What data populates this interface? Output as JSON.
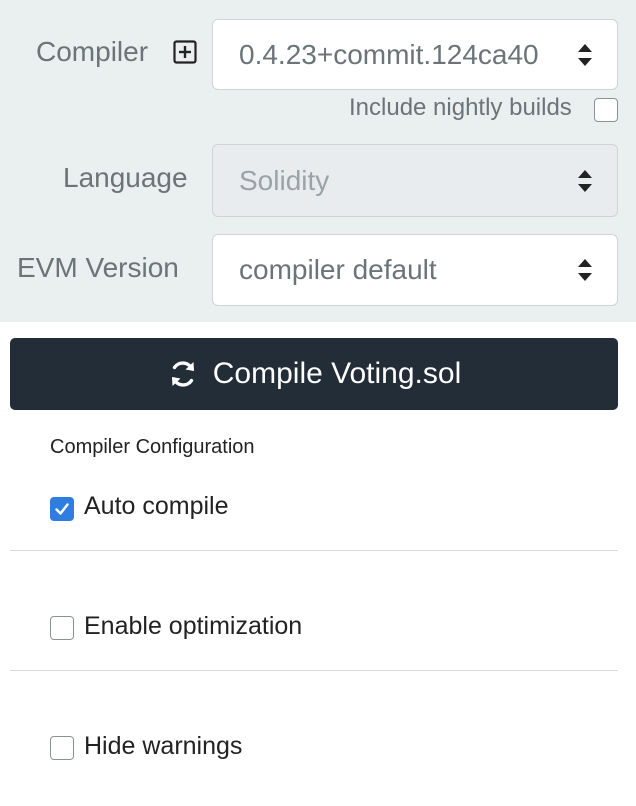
{
  "compiler": {
    "label": "Compiler",
    "version": "0.4.23+commit.124ca40",
    "nightly_label": "Include nightly builds",
    "nightly_checked": false
  },
  "language": {
    "label": "Language",
    "value": "Solidity"
  },
  "evm": {
    "label": "EVM Version",
    "value": "compiler default"
  },
  "compile_button": {
    "label": "Compile Voting.sol",
    "color": "#222d38"
  },
  "config": {
    "title": "Compiler Configuration",
    "options": [
      {
        "label": "Auto compile",
        "checked": true
      },
      {
        "label": "Enable optimization",
        "checked": false
      },
      {
        "label": "Hide warnings",
        "checked": false
      }
    ]
  },
  "colors": {
    "panel_bg": "#eaeff0",
    "checkbox_accent": "#2f7de1"
  }
}
